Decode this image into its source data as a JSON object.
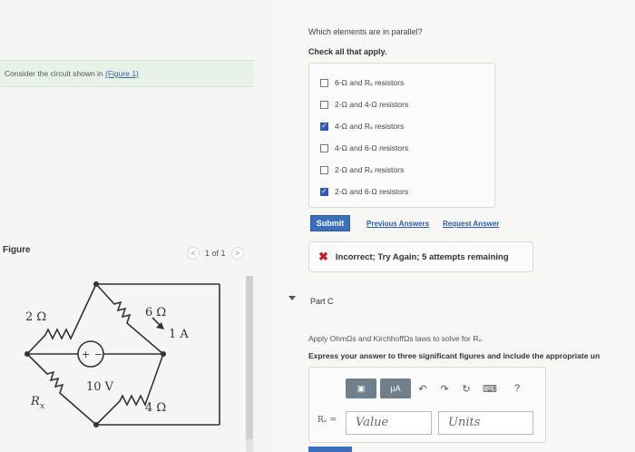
{
  "left": {
    "prompt_text": "Consider the circuit shown in ",
    "prompt_link": "(Figure 1)",
    "figure_title": "Figure",
    "pager": {
      "prev": "<",
      "label": "1 of 1",
      "next": ">"
    }
  },
  "circuit": {
    "r_left_top": "2 Ω",
    "r_right_top": "6 Ω",
    "current": "1 A",
    "source": "10 V",
    "r_right_bottom": "4 Ω",
    "r_left_bottom": "R",
    "r_left_bottom_sub": "x",
    "plus": "+",
    "minus": "−"
  },
  "question": {
    "prompt": "Which elements are in parallel?",
    "instruction": "Check all that apply.",
    "options": [
      {
        "label": "6-Ω and Rₓ resistors",
        "checked": false
      },
      {
        "label": "2-Ω and 4-Ω resistors",
        "checked": false
      },
      {
        "label": "4-Ω and Rₓ resistors",
        "checked": true
      },
      {
        "label": "4-Ω and 6-Ω resistors",
        "checked": false
      },
      {
        "label": "2-Ω and Rₓ resistors",
        "checked": false
      },
      {
        "label": "2-Ω and 6-Ω resistors",
        "checked": true
      }
    ],
    "check_mark": "✓",
    "submit": "Submit",
    "previous_answers": "Previous Answers",
    "request_answer": "Request Answer",
    "feedback_icon": "✖",
    "feedback": "Incorrect; Try Again; 5 attempts remaining"
  },
  "part_c": {
    "title": "Part C",
    "instruction1": "Apply OhmΩs and KirchhoffΩs laws to solve for Rₓ.",
    "instruction2": "Express your answer to three significant figures and include the appropriate un",
    "toolbar": {
      "template": "▣",
      "units": "μA",
      "undo": "↶",
      "redo": "↷",
      "reset": "↻",
      "keyboard": "⌨",
      "help": "?"
    },
    "answer_label": "Rₓ =",
    "value_placeholder": "Value",
    "units_placeholder": "Units"
  },
  "colors": {
    "accent": "#3b6fbe",
    "error": "#c8202a",
    "prompt_bg": "#e6f1e8"
  }
}
